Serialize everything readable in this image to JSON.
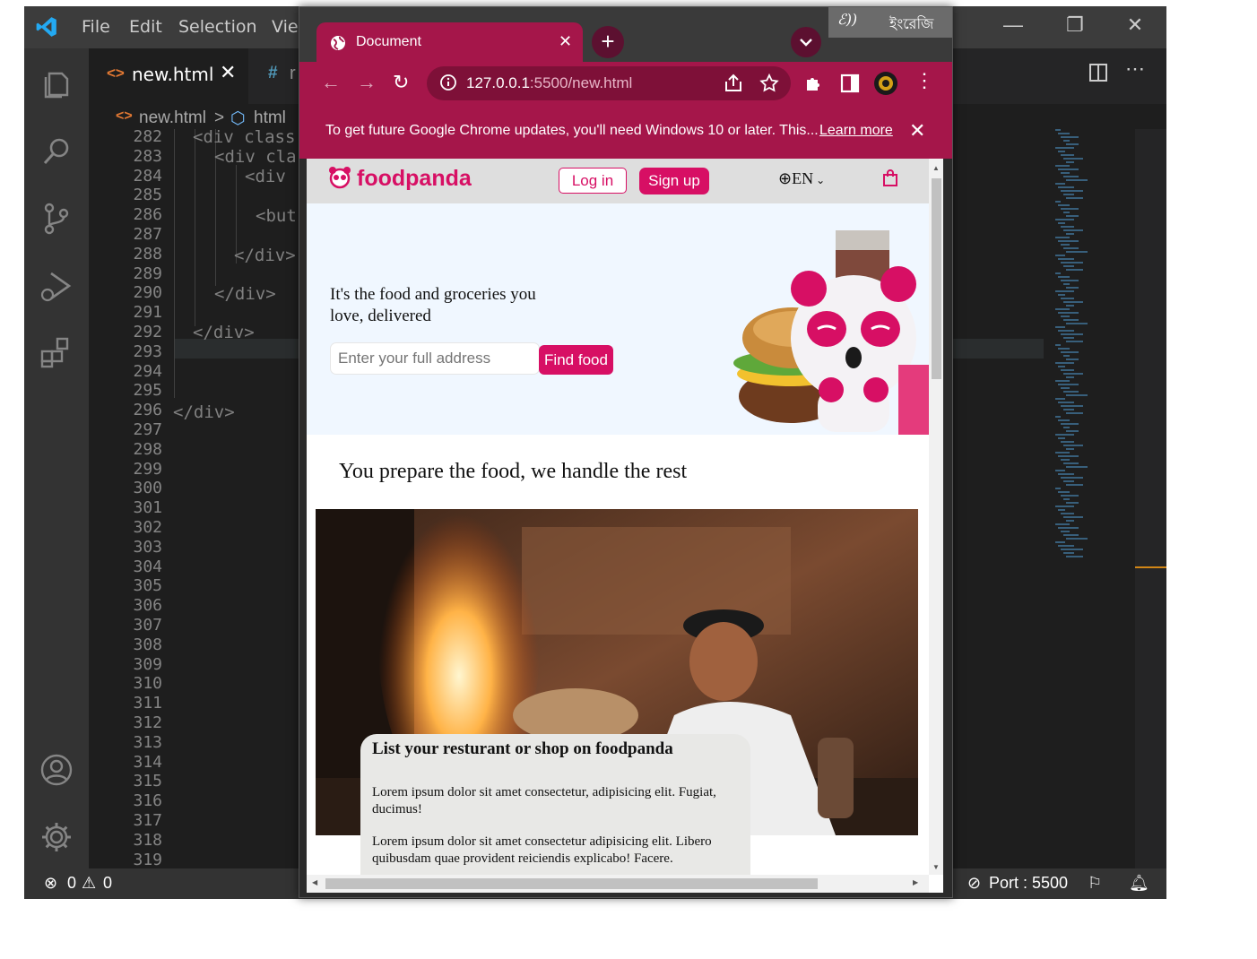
{
  "vscode": {
    "menu": [
      "File",
      "Edit",
      "Selection",
      "Vie"
    ],
    "tabs": [
      {
        "icon": "<>",
        "label": "new.html",
        "close": "✕"
      },
      {
        "icon": "#",
        "label": "r"
      }
    ],
    "breadcrumb": {
      "file": "new.html",
      "sep": ">",
      "node": "html"
    },
    "line_numbers": [
      "282",
      "283",
      "284",
      "285",
      "286",
      "287",
      "288",
      "289",
      "290",
      "291",
      "292",
      "293",
      "294",
      "295",
      "296",
      "297",
      "298",
      "299",
      "300",
      "301",
      "302",
      "303",
      "304",
      "305",
      "306",
      "307",
      "308",
      "309",
      "310",
      "311",
      "312",
      "313",
      "314",
      "315",
      "316",
      "317",
      "318",
      "319"
    ],
    "code": {
      "l282": "<div class",
      "l283": "<div cla",
      "l284": "<div",
      "l286": "<but",
      "l288": "</div>",
      "l290": "</div>",
      "l292": "</div>",
      "l296": "</div>"
    },
    "status": {
      "errors": "0",
      "warnings": "0",
      "port": "Port : 5500"
    }
  },
  "chrome": {
    "tab_title": "Document",
    "url_host": "127.0.0.1",
    "url_rest": ":5500/new.html",
    "ime_label": "ইংরেজি",
    "infobar": {
      "text": "To get future Google Chrome updates, you'll need Windows 10 or later. This...",
      "link": "Learn more"
    }
  },
  "page": {
    "brand": "foodpanda",
    "login": "Log in",
    "signup": "Sign up",
    "lang": "EN",
    "hero_headline": "It's the food and groceries you love, delivered",
    "address_placeholder": "Enter your full address",
    "find_food": "Find food",
    "sub_heading": "You prepare the food, we handle the rest",
    "card": {
      "title": "List your resturant or shop on foodpanda",
      "p1": "Lorem ipsum dolor sit amet consectetur, adipisicing elit. Fugiat, ducimus!",
      "p2": "Lorem ipsum dolor sit amet consectetur adipisicing elit. Libero quibusdam quae provident reiciendis explicabo! Facere."
    }
  },
  "colors": {
    "brand_pink": "#d70f64",
    "chrome_theme": "#a5164a",
    "vscode_bg": "#1e1e1e"
  }
}
